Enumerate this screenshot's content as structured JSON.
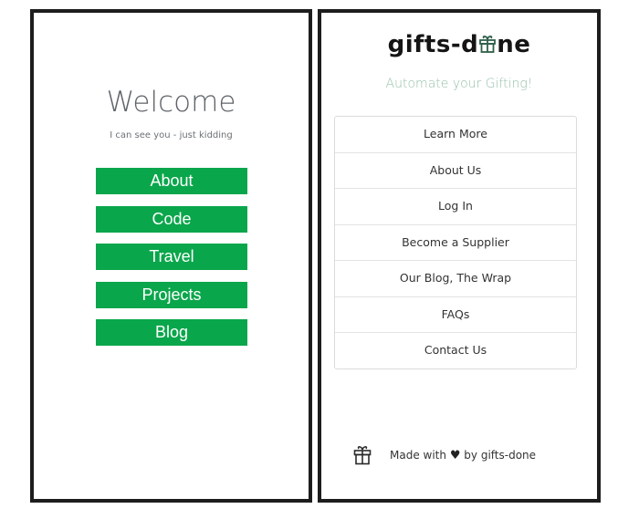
{
  "left": {
    "welcome": "Welcome",
    "subtitle": "I can see you - just kidding",
    "buttons": [
      {
        "label": "About"
      },
      {
        "label": "Code"
      },
      {
        "label": "Travel"
      },
      {
        "label": "Projects"
      },
      {
        "label": "Blog"
      }
    ]
  },
  "right": {
    "logo": {
      "before": "gifts-d",
      "after": "ne"
    },
    "tagline": "Automate your Gifting!",
    "links": [
      {
        "label": "Learn More"
      },
      {
        "label": "About Us"
      },
      {
        "label": "Log In"
      },
      {
        "label": "Become a Supplier"
      },
      {
        "label": "Our Blog, The Wrap"
      },
      {
        "label": "FAQs"
      },
      {
        "label": "Contact Us"
      }
    ],
    "footer": {
      "made_with": "Made with",
      "heart": "♥",
      "by": "by gifts-done"
    }
  },
  "colors": {
    "green": "#0aa64b",
    "tagline": "#97c1a8",
    "frame": "#1d1d1d"
  }
}
